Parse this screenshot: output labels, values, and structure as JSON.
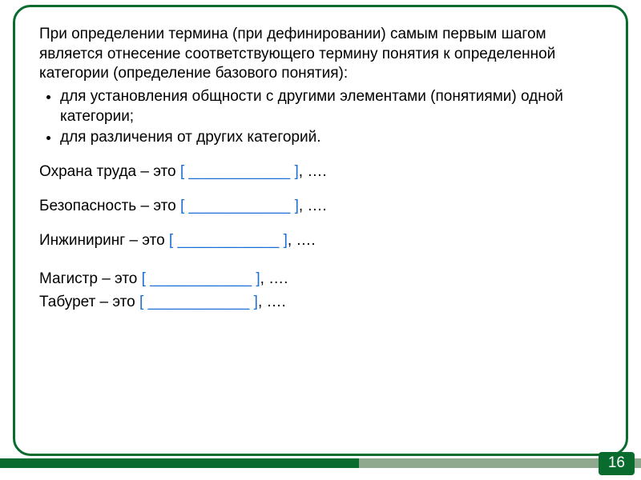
{
  "intro": "При определении термина (при дефинировании) самым первым шагом является отнесение соответствующего термину понятия к определенной категории (определение базового понятия):",
  "bullets": [
    "для установления общности с другими элементами (понятиями) одной категории;",
    "для различения от других категорий."
  ],
  "examples": [
    {
      "prefix": "Охрана труда – это ",
      "bracket_open": "[",
      "blank": " ____________ ",
      "bracket_close": "]",
      "suffix": ", …."
    },
    {
      "prefix": "Безопасность – это ",
      "bracket_open": "[",
      "blank": " ____________ ",
      "bracket_close": "]",
      "suffix": ", …."
    },
    {
      "prefix": "Инжиниринг – это ",
      "bracket_open": "[",
      "blank": " ____________ ",
      "bracket_close": "]",
      "suffix": ", …."
    },
    {
      "prefix": "Магистр – это ",
      "bracket_open": "[",
      "blank": " ____________ ",
      "bracket_close": "]",
      "suffix": ", …."
    },
    {
      "prefix": "Табурет – это ",
      "bracket_open": "[",
      "blank": " ____________ ",
      "bracket_close": "]",
      "suffix": ", …."
    }
  ],
  "page_number": "16",
  "colors": {
    "frame": "#0a6b2f",
    "bracket": "#1a6ed8",
    "bar_bg": "#8fa98f",
    "bar_fg": "#0a6b2f",
    "badge_bg": "#0a6b2f",
    "badge_fg": "#ffffff"
  }
}
